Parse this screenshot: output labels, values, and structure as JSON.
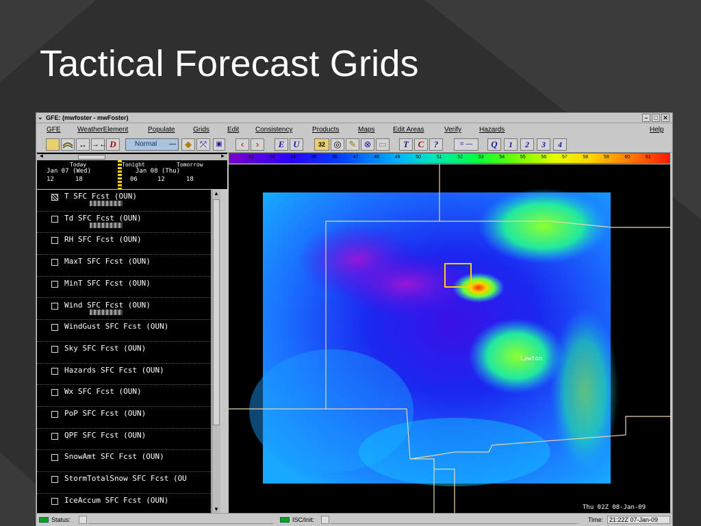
{
  "slide": {
    "title": "Tactical Forecast Grids"
  },
  "window": {
    "title": "GFE: (mwfoster - mwFoster)"
  },
  "menubar": {
    "items": [
      "GFE",
      "WeatherElement",
      "Populate",
      "Grids",
      "Edit",
      "Consistency",
      "Products",
      "Maps",
      "Edit Areas",
      "Verify",
      "Hazards"
    ],
    "help": "Help"
  },
  "toolbar": {
    "mode": "Normal",
    "letters_edit": [
      "E",
      "U"
    ],
    "letters_temporal": [
      "T",
      "C",
      "?"
    ],
    "q_label": "Q",
    "numbers": [
      "1",
      "2",
      "3",
      "4"
    ],
    "badge": "32",
    "dash_label": "= —",
    "delete_label": "D"
  },
  "timeline": {
    "days": [
      "Today",
      "Tonight",
      "Tomorrow"
    ],
    "dates": [
      "Jan 07 (Wed)",
      "Jan 08 (Thu)"
    ],
    "hours": [
      "12",
      "18",
      "06",
      "12",
      "18"
    ]
  },
  "elements": [
    {
      "label": "T SFC  Fcst (OUN)",
      "active": true,
      "has_grid": true
    },
    {
      "label": "Td SFC  Fcst (OUN)",
      "active": false,
      "has_grid": true
    },
    {
      "label": "RH SFC  Fcst (OUN)",
      "active": false,
      "has_grid": false
    },
    {
      "label": "MaxT SFC  Fcst (OUN)",
      "active": false,
      "has_grid": false
    },
    {
      "label": "MinT SFC  Fcst (OUN)",
      "active": false,
      "has_grid": false
    },
    {
      "label": "Wind SFC  Fcst (OUN)",
      "active": false,
      "has_grid": true
    },
    {
      "label": "WindGust SFC  Fcst (OUN)",
      "active": false,
      "has_grid": false
    },
    {
      "label": "Sky SFC  Fcst (OUN)",
      "active": false,
      "has_grid": false
    },
    {
      "label": "Hazards SFC  Fcst (OUN)",
      "active": false,
      "has_grid": false
    },
    {
      "label": "Wx SFC  Fcst (OUN)",
      "active": false,
      "has_grid": false
    },
    {
      "label": "PoP SFC  Fcst (OUN)",
      "active": false,
      "has_grid": false
    },
    {
      "label": "QPF SFC  Fcst (OUN)",
      "active": false,
      "has_grid": false
    },
    {
      "label": "SnowAmt SFC  Fcst (OUN)",
      "active": false,
      "has_grid": false
    },
    {
      "label": "StormTotalSnow SFC  Fcst (OU",
      "active": false,
      "has_grid": false
    },
    {
      "label": "IceAccum SFC  Fcst (OUN)",
      "active": false,
      "has_grid": false
    }
  ],
  "colorbar": {
    "ticks": [
      "42",
      "43",
      "44",
      "45",
      "46",
      "47",
      "48",
      "49",
      "50",
      "51",
      "52",
      "53",
      "54",
      "55",
      "56",
      "57",
      "58",
      "59",
      "60",
      "61"
    ]
  },
  "map": {
    "city_label": "Lawton",
    "timestamp": "Thu 02Z 08-Jan-09"
  },
  "statusbar": {
    "status_label": "Status:",
    "isc_label": "ISC/Init:",
    "time_label": "Time:",
    "time_value": "21:22Z 07-Jan-09"
  }
}
